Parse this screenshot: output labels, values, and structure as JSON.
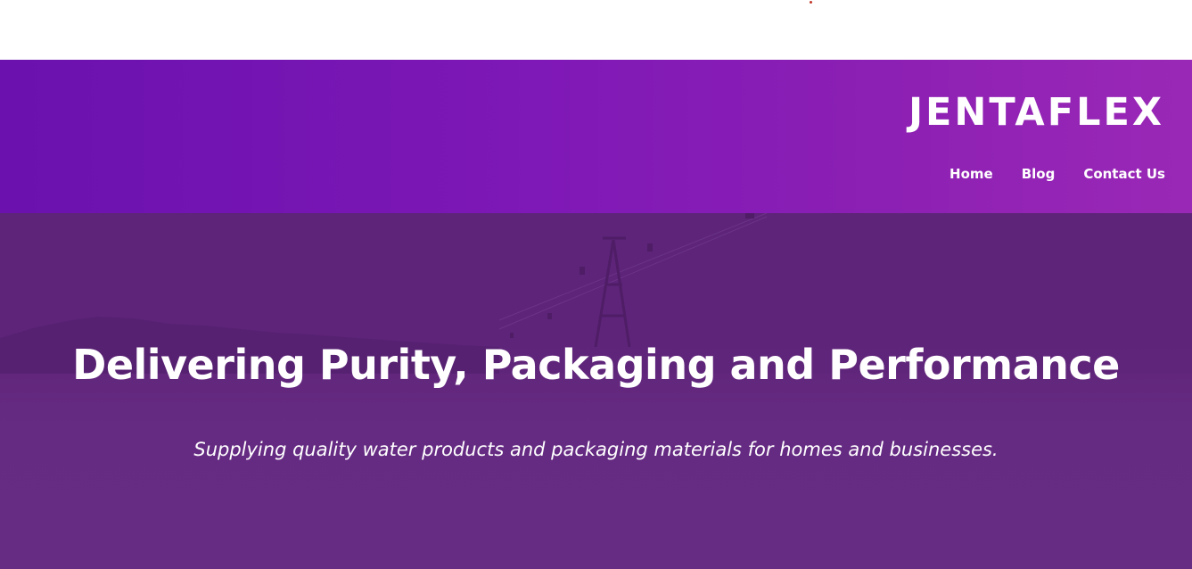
{
  "header": {
    "brand": "JENTAFLEX",
    "nav": [
      {
        "label": "Home"
      },
      {
        "label": "Blog"
      },
      {
        "label": "Contact Us"
      }
    ]
  },
  "hero": {
    "title": "Delivering Purity, Packaging and Performance",
    "subtitle": "Supplying quality water products and packaging materials for homes and businesses."
  },
  "colors": {
    "header_gradient_start": "#6a11ae",
    "header_gradient_end": "#9a28b6",
    "hero_overlay": "#632882",
    "text": "#ffffff"
  }
}
